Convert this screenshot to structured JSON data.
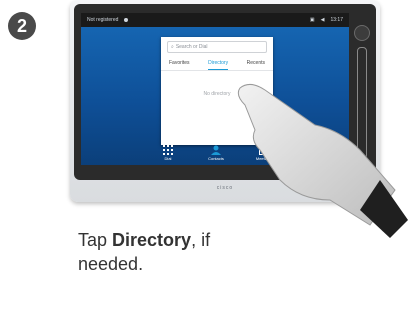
{
  "step": "2",
  "status_bar": {
    "left_text": "Not registered",
    "time": "13:17"
  },
  "panel": {
    "search_placeholder": "Search or Dial",
    "tabs": [
      "Favorites",
      "Directory",
      "Recents"
    ],
    "active_tab": "Directory",
    "empty_message": "No directory"
  },
  "bottom_nav": [
    "Dial",
    "Contacts",
    "Meetings"
  ],
  "logo": "cisco",
  "caption": {
    "prefix": "Tap ",
    "bold": "Directory",
    "suffix": ", if",
    "line2": "needed."
  },
  "colors": {
    "screen": "#1769b6",
    "active_tab": "#1b9ad6"
  }
}
